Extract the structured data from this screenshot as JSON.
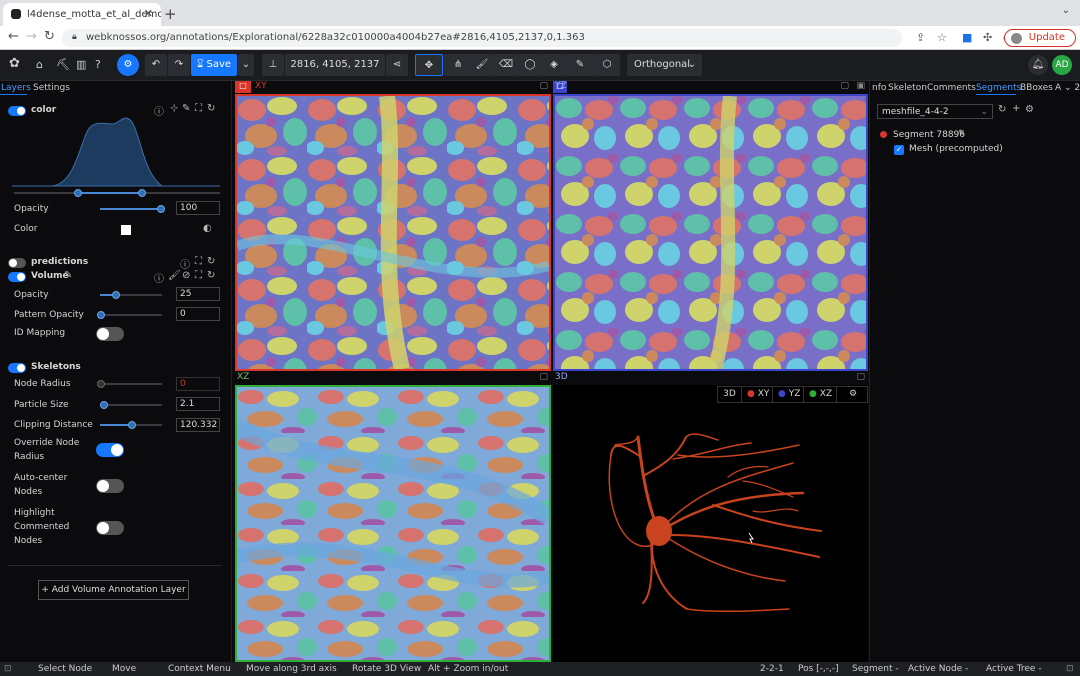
{
  "browser": {
    "tab_title": "l4dense_motta_et_al_demo | …",
    "url": "webknossos.org/annotations/Explorational/6228a32c010000a4004b27ea#2816,4105,2137,0,1.363",
    "update_label": "Update"
  },
  "toolbar": {
    "save_label": "Save",
    "position": "2816, 4105, 2137",
    "view_mode": "Orthogonal",
    "avatar": "AD"
  },
  "left_tabs": {
    "layers": "Layers",
    "settings": "Settings"
  },
  "color_layer": {
    "name": "color",
    "opacity_label": "Opacity",
    "opacity_value": "100",
    "color_label": "Color",
    "opacity_fraction": 1.0
  },
  "predictions": {
    "name": "predictions"
  },
  "volume": {
    "name": "Volume",
    "opacity_label": "Opacity",
    "opacity_value": "25",
    "pattern_label": "Pattern Opacity",
    "pattern_value": "0",
    "idmap_label": "ID Mapping"
  },
  "skeletons": {
    "name": "Skeletons",
    "node_radius_label": "Node Radius",
    "node_radius_value": "0",
    "particle_label": "Particle Size",
    "particle_value": "2.1",
    "clipping_label": "Clipping Distance",
    "clipping_value": "120.332",
    "override_label_1": "Override Node",
    "override_label_2": "Radius",
    "autocenter_label_1": "Auto-center",
    "autocenter_label_2": "Nodes",
    "highlight_label_1": "Highlight",
    "highlight_label_2": "Commented",
    "highlight_label_3": "Nodes"
  },
  "add_volume_label": "+ Add Volume Annotation Layer",
  "viewports": {
    "xy": "XY",
    "yz": "YZ",
    "xz": "XZ",
    "td": "3D",
    "btn_3d": "3D",
    "btn_xy": "XY",
    "btn_yz": "YZ",
    "btn_xz": "XZ"
  },
  "right_tabs": [
    "nfo",
    "Skeleton",
    "Comments",
    "Segments",
    "BBoxes",
    "A"
  ],
  "segments": {
    "mesh_file": "meshfile_4-4-2",
    "segment_name": "Segment 78896",
    "mesh_label": "Mesh (precomputed)"
  },
  "status": [
    "Select Node",
    "Move",
    "Context Menu",
    "Move along 3rd axis",
    "Rotate 3D View",
    "Alt + Zoom in/out",
    "2-2-1",
    "Pos [-,-,-]",
    "Segment -",
    "Active Node -",
    "Active Tree -"
  ],
  "colors": {
    "accent": "#1677ff",
    "xy": "#d9362a",
    "yz": "#3b45c9",
    "xz": "#2fae3a",
    "neuron": "#c8431e"
  }
}
